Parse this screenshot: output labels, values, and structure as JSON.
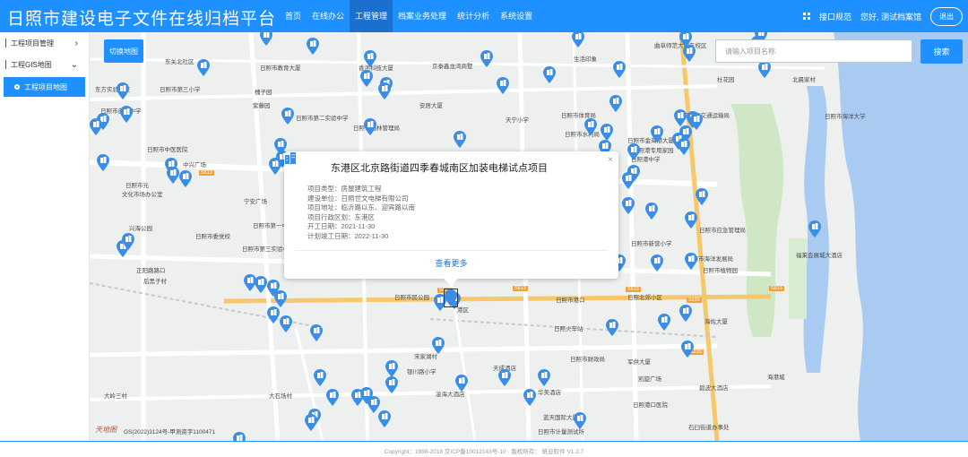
{
  "app": {
    "title": "日照市建设电子文件在线归档平台",
    "nav": [
      "首页",
      "在线办公",
      "工程管理",
      "档案业务处理",
      "统计分析",
      "系统设置"
    ],
    "active_nav": "工程管理",
    "api_link": "接口规范",
    "greeting": "您好, 测试档案馆",
    "logout": "退出",
    "brand_color": "#1e90ff"
  },
  "sidebar": {
    "items": [
      {
        "label": "工程项目管理",
        "chevron": "›"
      },
      {
        "label": "工程GIS地图",
        "chevron": "⌄"
      }
    ],
    "sub_item": "工程项目地图"
  },
  "map": {
    "switch_button": "切换地图",
    "search_placeholder": "请输入项目名称",
    "search_button": "搜索",
    "labels": [
      "东关北社区",
      "日照市教育大厦",
      "香河科技大厦",
      "京泰鑫龙湾商墅",
      "生活印象",
      "曲阜师范大学东校区",
      "东方实验学校",
      "北晨家村",
      "日照市第三小学",
      "日照市自主中学",
      "槐子园",
      "紫藤园",
      "安居大厦",
      "杜花园",
      "日照市第二实验中学",
      "天宁小学",
      "日照市体育局",
      "日照市交通运输局",
      "日照市海洋大学",
      "日照市中医医院",
      "日照市园林管理局",
      "日照市水利局",
      "日照港专用家园",
      "中兴广场",
      "日照市金海港大厦",
      "日照市元",
      "日照港中学",
      "文化市场办公室",
      "宁安广场",
      "日照市第一中学",
      "兴海公园",
      "日照市委党校",
      "日照市第三实验小学",
      "日照市新营小学",
      "日照市海洋发展局",
      "日照市应急管理局",
      "日照市植物园",
      "正阳路路口",
      "后黑子村",
      "日照市民公园",
      "港区",
      "日照市港口",
      "日照火车站",
      "海佐大厦",
      "日照北郊小区",
      "宋家湖村",
      "银川路小学",
      "天成酒店",
      "日照市财政局",
      "军供大厦",
      "凯旋广场",
      "碧波大酒店",
      "大岭三村",
      "大石场村",
      "凌海大酒店",
      "华美酒店",
      "日照港口医院",
      "蓝天国际大厦",
      "日照市计量测试所",
      "石臼街道办事处",
      "海港城",
      "福莱会展城大酒店"
    ],
    "road_shields": [
      "S613",
      "S613",
      "S613",
      "S613",
      "S220",
      "S220",
      "S613"
    ],
    "logo_text": "天地图",
    "copyright": "GS(2022)3124号-甲测资字1100471",
    "marker_color": "#3a8ee6"
  },
  "popup": {
    "title": "东港区北京路街道四季春城南区加装电梯试点项目",
    "close": "×",
    "fields": [
      {
        "label": "项目类型：",
        "value": "房屋建筑工程"
      },
      {
        "label": "建设单位：",
        "value": "日照世文电梯有限公司"
      },
      {
        "label": "项目地址：",
        "value": "临沂路以东、迎宾路以南"
      },
      {
        "label": "项目行政区划：",
        "value": "东港区"
      },
      {
        "label": "开工日期：",
        "value": "2021-11-30"
      },
      {
        "label": "计划竣工日期：",
        "value": "2022-11-30"
      }
    ],
    "more": "查看更多"
  },
  "footer": {
    "text": "Copyright：1998-2018 京ICP备10012143号-10 · 版权所有： 筑业软件 V1.2.7"
  }
}
